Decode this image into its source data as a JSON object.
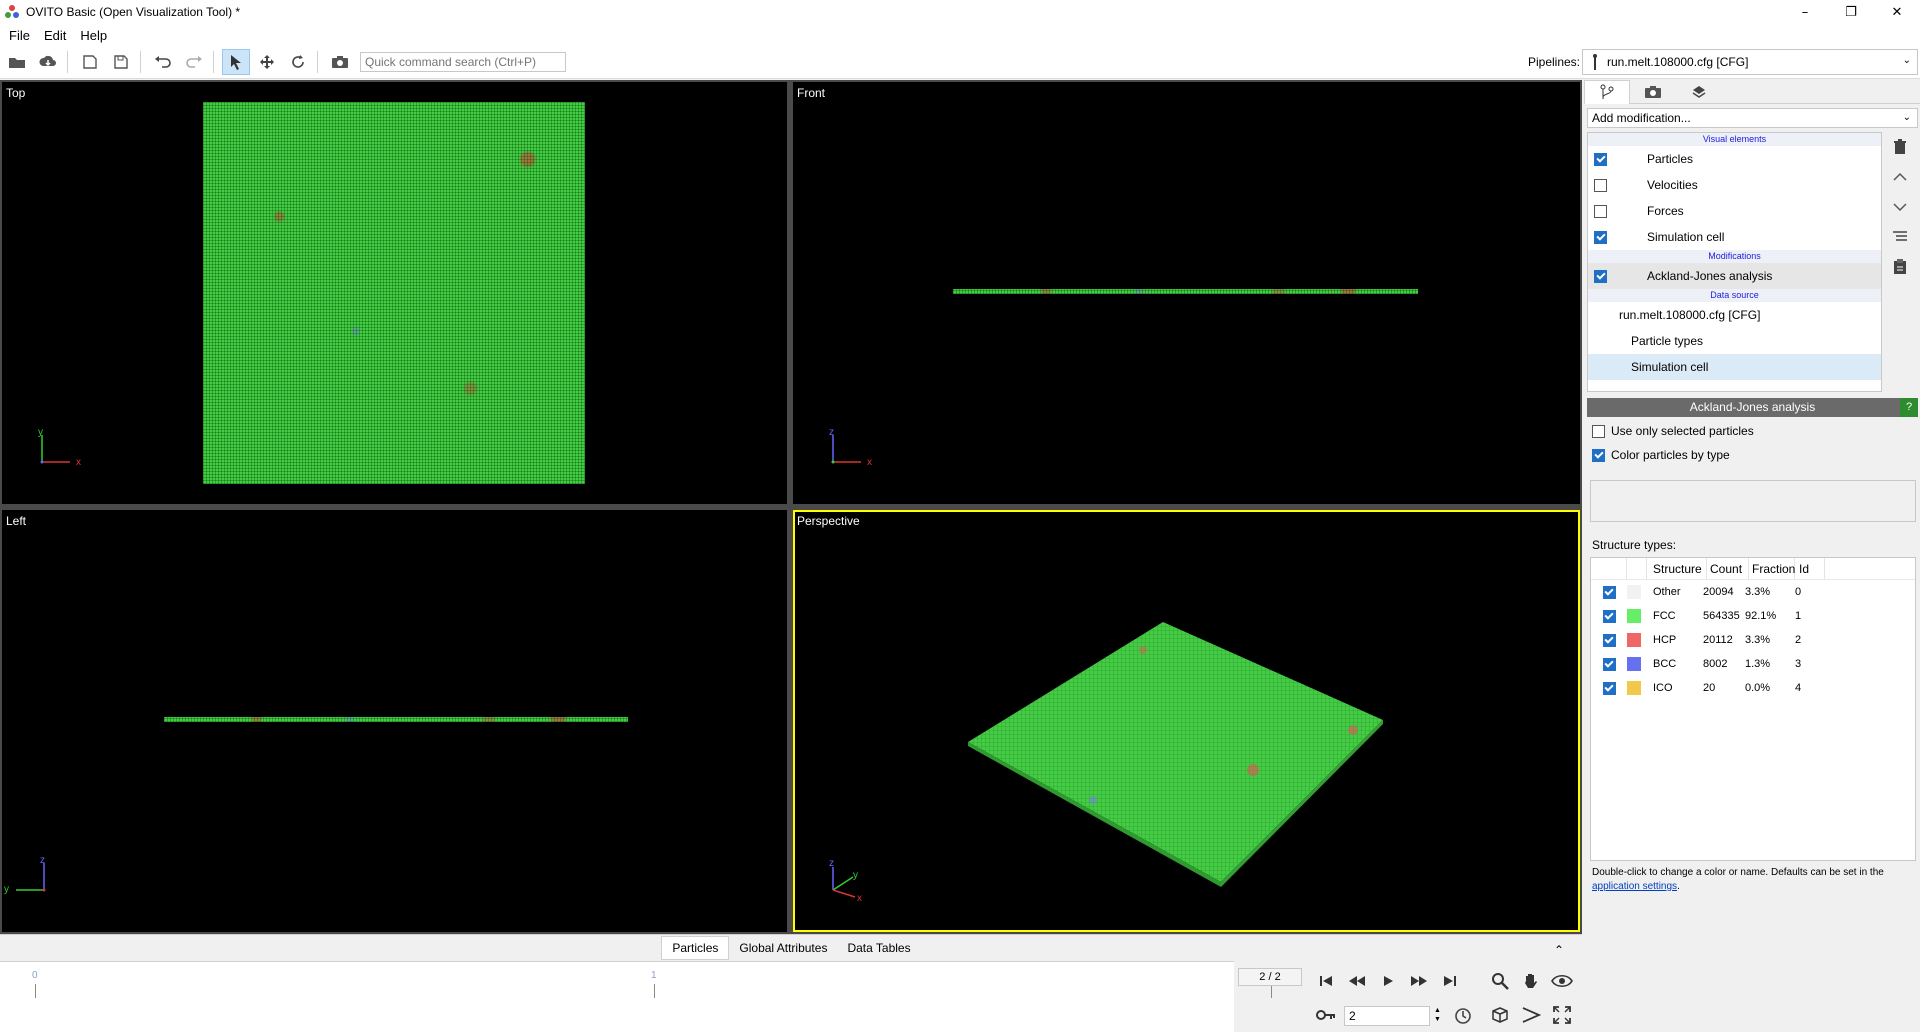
{
  "window": {
    "title": "OVITO Basic (Open Visualization Tool) *"
  },
  "menu": [
    "File",
    "Edit",
    "Help"
  ],
  "toolbar": {
    "search_placeholder": "Quick command search (Ctrl+P)"
  },
  "pipelines": {
    "label": "Pipelines:",
    "selected": "run.melt.108000.cfg [CFG]"
  },
  "viewports": {
    "top": "Top",
    "front": "Front",
    "left": "Left",
    "perspective": "Perspective"
  },
  "axes": {
    "x": "x",
    "y": "y",
    "z": "z"
  },
  "panel": {
    "add_modification": "Add modification...",
    "sections": {
      "visual": "Visual elements",
      "mods": "Modifications",
      "source": "Data source"
    },
    "visual_elements": [
      {
        "label": "Particles",
        "checked": true
      },
      {
        "label": "Velocities",
        "checked": false
      },
      {
        "label": "Forces",
        "checked": false
      },
      {
        "label": "Simulation cell",
        "checked": true
      }
    ],
    "modifications": [
      {
        "label": "Ackland-Jones analysis",
        "checked": true
      }
    ],
    "data_source": {
      "file": "run.melt.108000.cfg [CFG]",
      "items": [
        "Particle types",
        "Simulation cell"
      ]
    }
  },
  "modifier": {
    "title": "Ackland-Jones analysis",
    "help": "?",
    "options": [
      {
        "label": "Use only selected particles",
        "checked": false
      },
      {
        "label": "Color particles by type",
        "checked": true
      }
    ],
    "structure_label": "Structure types:",
    "columns": [
      "Structure",
      "Count",
      "Fraction",
      "Id"
    ],
    "rows": [
      {
        "name": "Other",
        "count": "20094",
        "fraction": "3.3%",
        "id": "0",
        "color": "#f2f2f2"
      },
      {
        "name": "FCC",
        "count": "564335",
        "fraction": "92.1%",
        "id": "1",
        "color": "#66ee66"
      },
      {
        "name": "HCP",
        "count": "20112",
        "fraction": "3.3%",
        "id": "2",
        "color": "#f06666"
      },
      {
        "name": "BCC",
        "count": "8002",
        "fraction": "1.3%",
        "id": "3",
        "color": "#6670f0"
      },
      {
        "name": "ICO",
        "count": "20",
        "fraction": "0.0%",
        "id": "4",
        "color": "#f2c84a"
      }
    ],
    "hint_text": "Double-click to change a color or name. Defaults can be set in the",
    "hint_link": "application settings",
    "hint_end": "."
  },
  "data_tabs": [
    "Particles",
    "Global Attributes",
    "Data Tables"
  ],
  "timeline": {
    "tick0": "0",
    "tick1": "1",
    "frame_display": "2 / 2",
    "frame_value": "2"
  },
  "colors": {
    "active_viewport": "#ffff00",
    "fcc_green": "#44cc44",
    "accent": "#1f6fc5"
  }
}
